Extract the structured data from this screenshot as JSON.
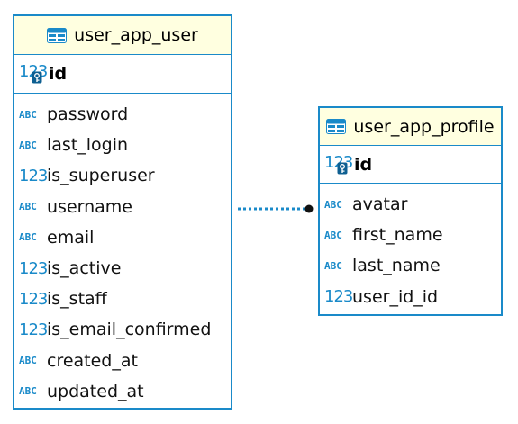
{
  "entities": [
    {
      "name": "user_app_user",
      "pk": {
        "name": "id",
        "type": "123"
      },
      "columns": [
        {
          "name": "password",
          "type": "ABC"
        },
        {
          "name": "last_login",
          "type": "ABC"
        },
        {
          "name": "is_superuser",
          "type": "123"
        },
        {
          "name": "username",
          "type": "ABC"
        },
        {
          "name": "email",
          "type": "ABC"
        },
        {
          "name": "is_active",
          "type": "123"
        },
        {
          "name": "is_staff",
          "type": "123"
        },
        {
          "name": "is_email_confirmed",
          "type": "123"
        },
        {
          "name": "created_at",
          "type": "ABC"
        },
        {
          "name": "updated_at",
          "type": "ABC"
        }
      ]
    },
    {
      "name": "user_app_profile",
      "pk": {
        "name": "id",
        "type": "123"
      },
      "columns": [
        {
          "name": "avatar",
          "type": "ABC"
        },
        {
          "name": "first_name",
          "type": "ABC"
        },
        {
          "name": "last_name",
          "type": "ABC"
        },
        {
          "name": "user_id_id",
          "type": "123"
        }
      ]
    }
  ],
  "relationship": {
    "from": "user_app_user",
    "to": "user_app_profile",
    "style": "dotted",
    "color": "#1a8ac9"
  },
  "colors": {
    "border": "#1a8ac9",
    "header_bg": "#ffffe0",
    "icon": "#1a8ac9"
  },
  "icons": {
    "table": "table-icon",
    "text_type": "abc-type-icon",
    "numeric_type": "numeric-type-icon",
    "primary_key": "key-icon"
  }
}
